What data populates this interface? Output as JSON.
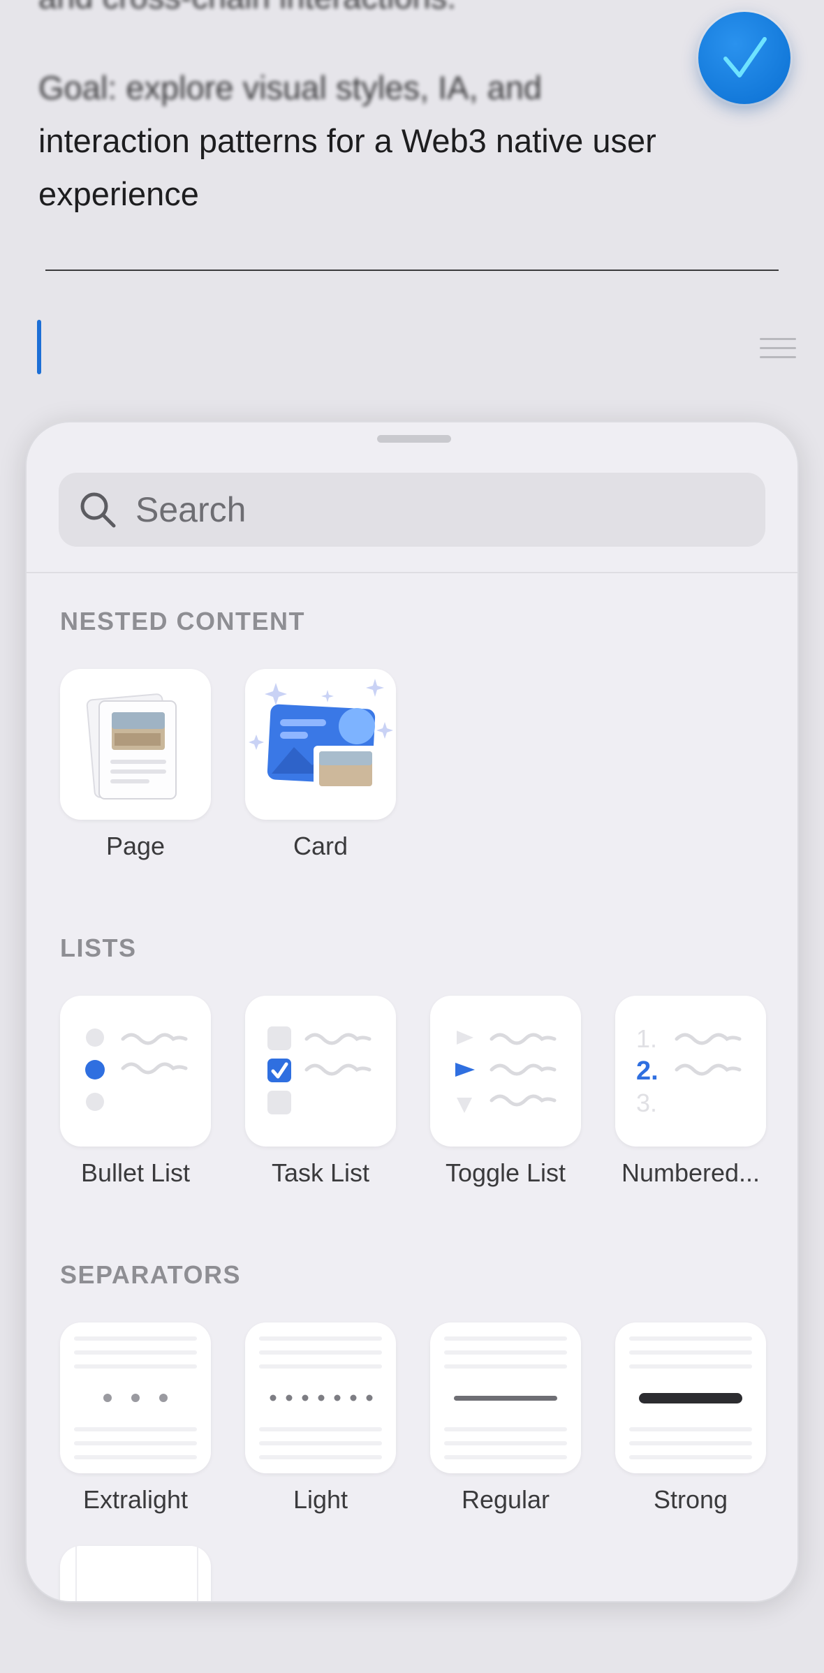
{
  "document": {
    "lines": [
      "and cross-chain interactions.",
      "Goal: explore visual styles, IA, and",
      "interaction patterns for a Web3 native user",
      "experience"
    ]
  },
  "done_button": {
    "icon": "checkmark-icon",
    "color": "#0f7bdc"
  },
  "sheet": {
    "search": {
      "placeholder": "Search",
      "value": ""
    },
    "sections": [
      {
        "title": "NESTED CONTENT",
        "items": [
          {
            "label": "Page",
            "icon": "page-icon"
          },
          {
            "label": "Card",
            "icon": "card-icon"
          }
        ]
      },
      {
        "title": "LISTS",
        "items": [
          {
            "label": "Bullet List",
            "icon": "bullet-list-icon"
          },
          {
            "label": "Task List",
            "icon": "task-list-icon"
          },
          {
            "label": "Toggle List",
            "icon": "toggle-list-icon"
          },
          {
            "label": "Numbered...",
            "icon": "numbered-list-icon"
          }
        ]
      },
      {
        "title": "SEPARATORS",
        "items": [
          {
            "label": "Extralight",
            "icon": "separator-extralight-icon"
          },
          {
            "label": "Light",
            "icon": "separator-light-icon"
          },
          {
            "label": "Regular",
            "icon": "separator-regular-icon"
          },
          {
            "label": "Strong",
            "icon": "separator-strong-icon"
          }
        ]
      }
    ],
    "numbered_icon_digits": [
      "1.",
      "2.",
      "3."
    ]
  },
  "colors": {
    "accent": "#2f6fe0",
    "caret": "#1d6fd6"
  }
}
